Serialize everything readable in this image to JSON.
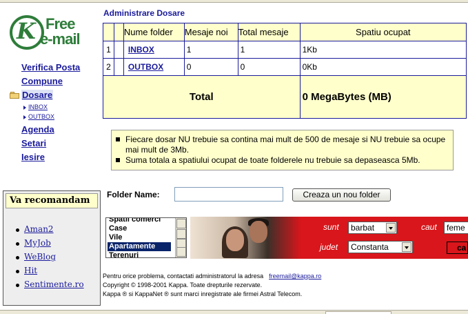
{
  "sidebar": {
    "logo": {
      "free": "Free",
      "email": "e-mail",
      "k": "K"
    },
    "nav": {
      "verifica": "Verifica Posta",
      "compune": "Compune",
      "dosare": "Dosare",
      "sub_inbox": "INBOX",
      "sub_outbox": "OUTBOX",
      "agenda": "Agenda",
      "setari": "Setari",
      "iesire": "Iesire"
    },
    "recommend": {
      "title": "Va recomandam",
      "items": [
        "Aman2",
        "MyJob",
        "WeBlog",
        "Hit",
        "Sentimente.ro"
      ]
    }
  },
  "main": {
    "title": "Administrare Dosare",
    "table": {
      "headers": [
        "",
        "Nume folder",
        "Mesaje noi",
        "Total mesaje",
        "Spatiu ocupat"
      ],
      "rows": [
        {
          "idx": "1",
          "name": "INBOX",
          "new": "1",
          "total": "1",
          "size": "1Kb"
        },
        {
          "idx": "2",
          "name": "OUTBOX",
          "new": "0",
          "total": "0",
          "size": "0Kb"
        }
      ],
      "total_label": "Total",
      "total_value": "0 MegaBytes (MB)"
    },
    "notes": [
      "Fiecare dosar NU trebuie sa contina mai mult de 500 de mesaje si NU trebuie sa ocupe mai mult de 3Mb.",
      "Suma totala a spatiului ocupat de toate folderele nu trebuie sa depaseasca 5Mb."
    ],
    "form": {
      "label": "Folder Name:",
      "input_value": "",
      "button": "Creaza un nou folder"
    },
    "ad": {
      "list_items": [
        "Spatii comerci",
        "Case",
        "Vile",
        "Apartamente",
        "Terenuri"
      ],
      "selected_index": 3,
      "sunt_label": "sunt",
      "sunt_value": "barbat",
      "caut_label": "caut",
      "caut_value": "feme",
      "judet_label": "judet",
      "judet_value": "Constanta",
      "cauta_button": "ca"
    },
    "footer": {
      "line1": "Pentru orice problema, contactati administratorul la adresa",
      "email": "freemail@kappa.ro",
      "line2": "Copyright © 1998-2001 Kappa. Toate drepturile rezervate.",
      "line3": "Kappa ® si KappaNet ® sunt marci inregistrate ale firmei Astral Telecom."
    }
  },
  "colors": {
    "link": "#1a1a9c",
    "header_bg": "#ffffcc",
    "logo_green": "#2e7d3a",
    "ad_red": "#d8161b"
  }
}
